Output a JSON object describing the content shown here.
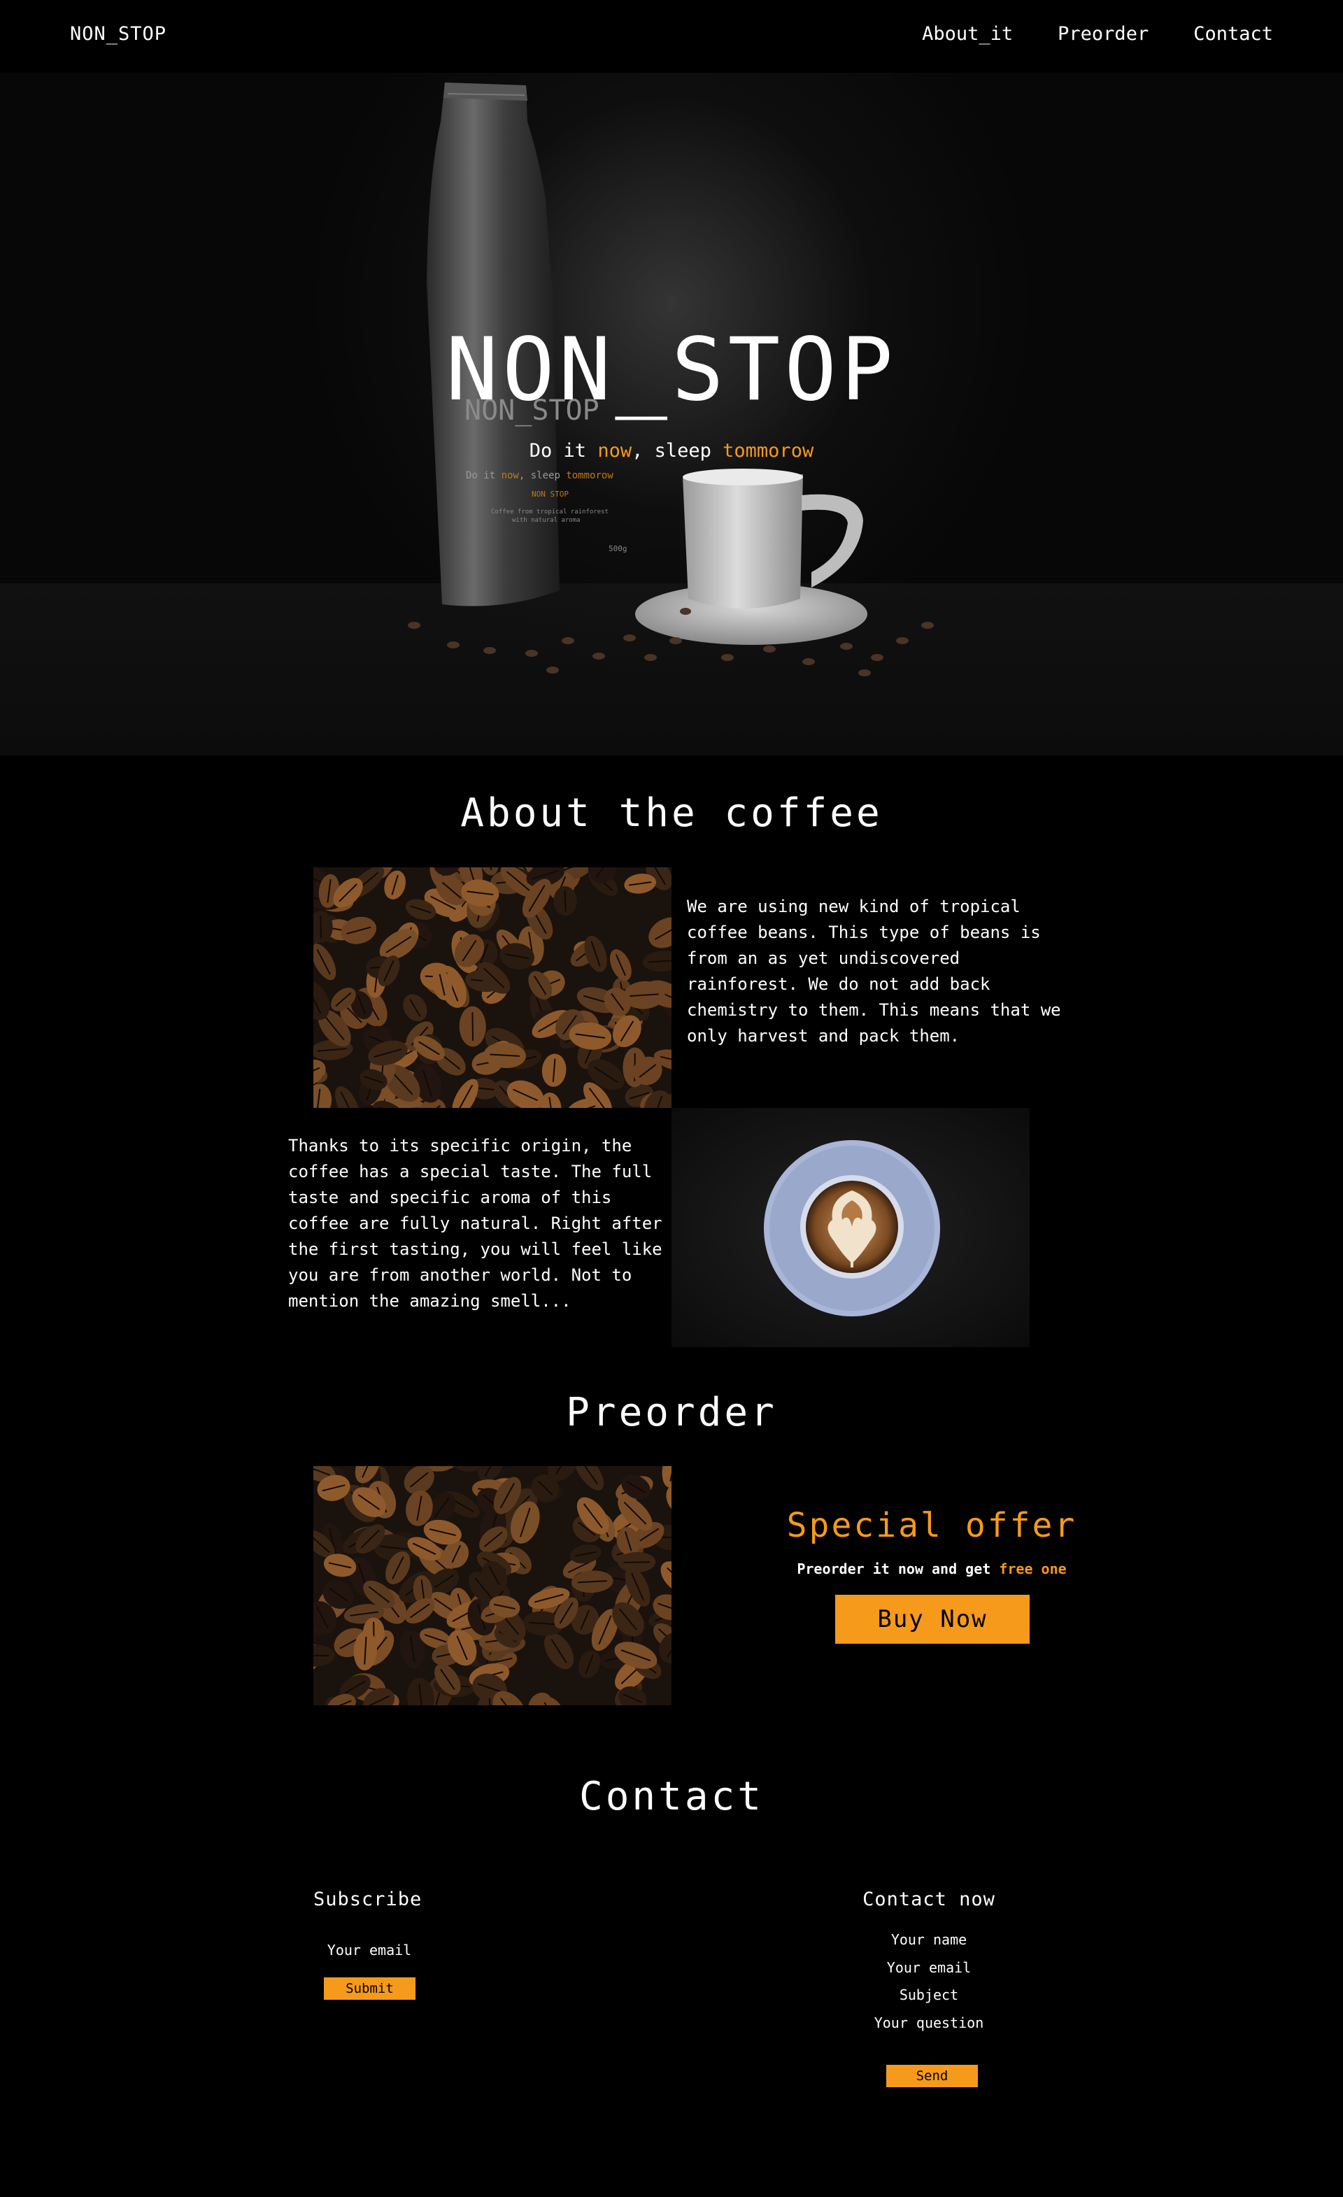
{
  "nav": {
    "logo": "NON_STOP",
    "links": [
      "About_it",
      "Preorder",
      "Contact"
    ]
  },
  "hero": {
    "title": "NON_STOP",
    "tagline": {
      "part1": "Do it ",
      "now": "now",
      "part2": ", sleep ",
      "tomorrow": "tommorow"
    },
    "bag_label": {
      "brand": "NON_STOP",
      "tagline_part1": "Do it ",
      "tagline_now": "now",
      "tagline_part2": ", sleep ",
      "tagline_tomorrow": "tommorow",
      "small_brand": "NON STOP",
      "origin_line1": "Coffee from tropical rainforest",
      "origin_line2": "with natural aroma",
      "weight": "500g"
    }
  },
  "about": {
    "title": "About the coffee",
    "paragraph1": "We are using new kind of tropical\ncoffee beans. This type of beans is\nfrom an as yet undiscovered\nrainforest. We do not add back\nchemistry to them. This means that we\nonly harvest and pack them.",
    "paragraph2": "Thanks to its specific origin, the\ncoffee has a special taste. The full\ntaste and specific aroma of this\ncoffee are fully natural. Right after\nthe first tasting, you will feel like\nyou are from another world. Not to\nmention the amazing smell..."
  },
  "preorder": {
    "title": "Preorder",
    "offer_title": "Special offer",
    "offer_text": "Preorder it now and get ",
    "offer_highlight": "free one",
    "button": "Buy Now"
  },
  "contact": {
    "title": "Contact",
    "subscribe": {
      "title": "Subscribe",
      "email_label": "Your email",
      "submit": "Submit"
    },
    "contact_now": {
      "title": "Contact now",
      "fields": [
        "Your name",
        "Your email",
        "Subject",
        "Your question"
      ],
      "send": "Send"
    }
  },
  "colors": {
    "accent": "#f59a1b",
    "background": "#000000",
    "text": "#ffffff"
  }
}
